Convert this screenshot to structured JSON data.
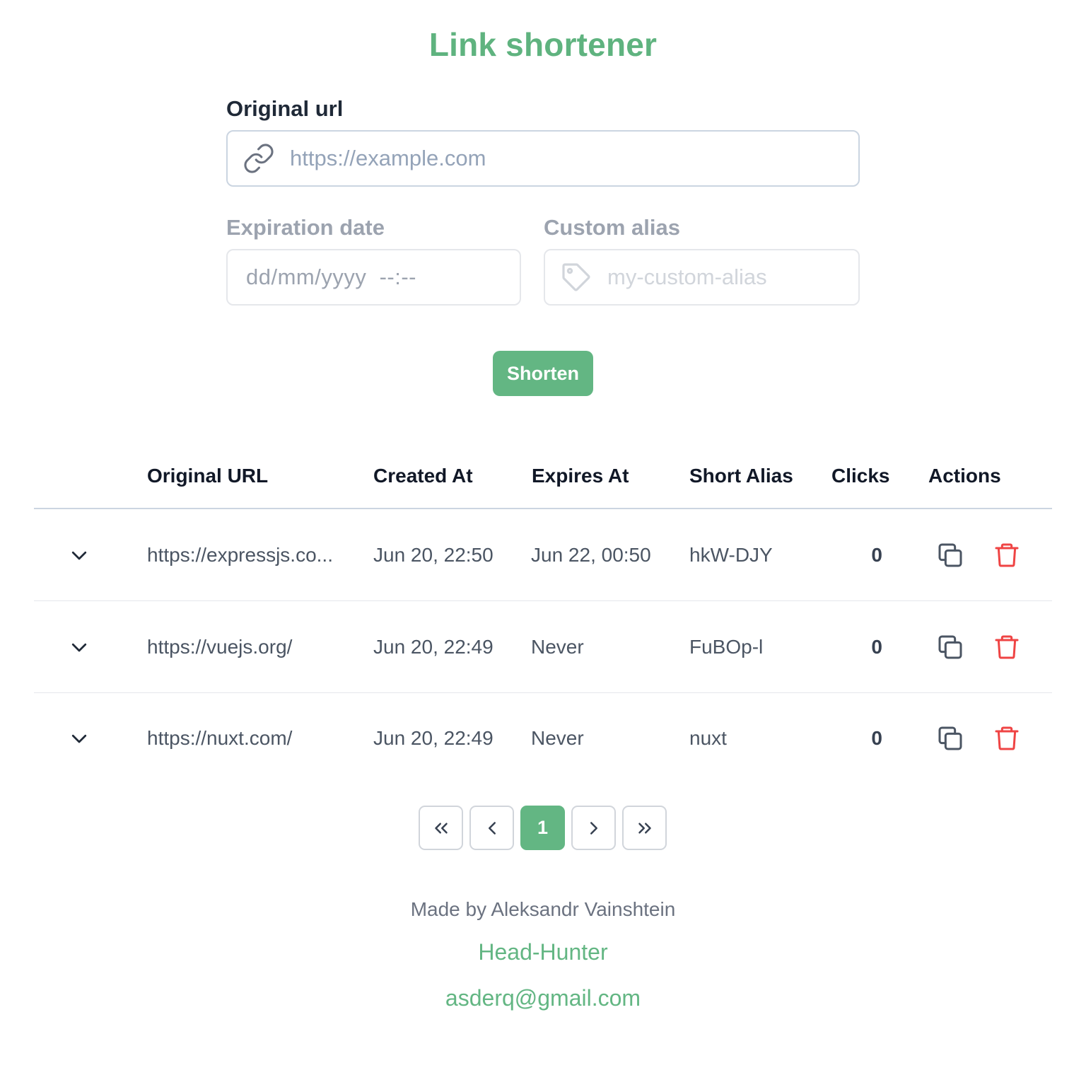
{
  "app": {
    "title": "Link shortener"
  },
  "form": {
    "original_url_label": "Original url",
    "original_url_placeholder": "https://example.com",
    "original_url_value": "",
    "expiration_label": "Expiration date",
    "expiration_placeholder": "dd/mm/yyyy  --:--",
    "alias_label": "Custom alias",
    "alias_placeholder": "my-custom-alias",
    "alias_value": "",
    "submit_label": "Shorten",
    "link_icon": "link-icon",
    "tag_icon": "tag-icon"
  },
  "table": {
    "headers": {
      "original_url": "Original URL",
      "created_at": "Created At",
      "expires_at": "Expires At",
      "short_alias": "Short Alias",
      "clicks": "Clicks",
      "actions": "Actions"
    },
    "rows": [
      {
        "original_url": "https://expressjs.co...",
        "created_at": "Jun 20, 22:50",
        "expires_at": "Jun 22, 00:50",
        "short_alias": "hkW-DJY",
        "clicks": "0"
      },
      {
        "original_url": "https://vuejs.org/",
        "created_at": "Jun 20, 22:49",
        "expires_at": "Never",
        "short_alias": "FuBOp-l",
        "clicks": "0"
      },
      {
        "original_url": "https://nuxt.com/",
        "created_at": "Jun 20, 22:49",
        "expires_at": "Never",
        "short_alias": "nuxt",
        "clicks": "0"
      }
    ],
    "row_icons": [
      "chevron-down-icon",
      "copy-icon",
      "trash-icon"
    ]
  },
  "pagination": {
    "first": "«",
    "prev": "‹",
    "current": "1",
    "next": "›",
    "last": "»"
  },
  "footer": {
    "made_by": "Made by Aleksandr Vainshtein",
    "link_hh": "Head-Hunter",
    "link_email": "asderq@gmail.com"
  },
  "colors": {
    "accent": "#63b683",
    "title": "#5fb37f",
    "danger": "#ef4444",
    "border": "#cbd5e1"
  }
}
